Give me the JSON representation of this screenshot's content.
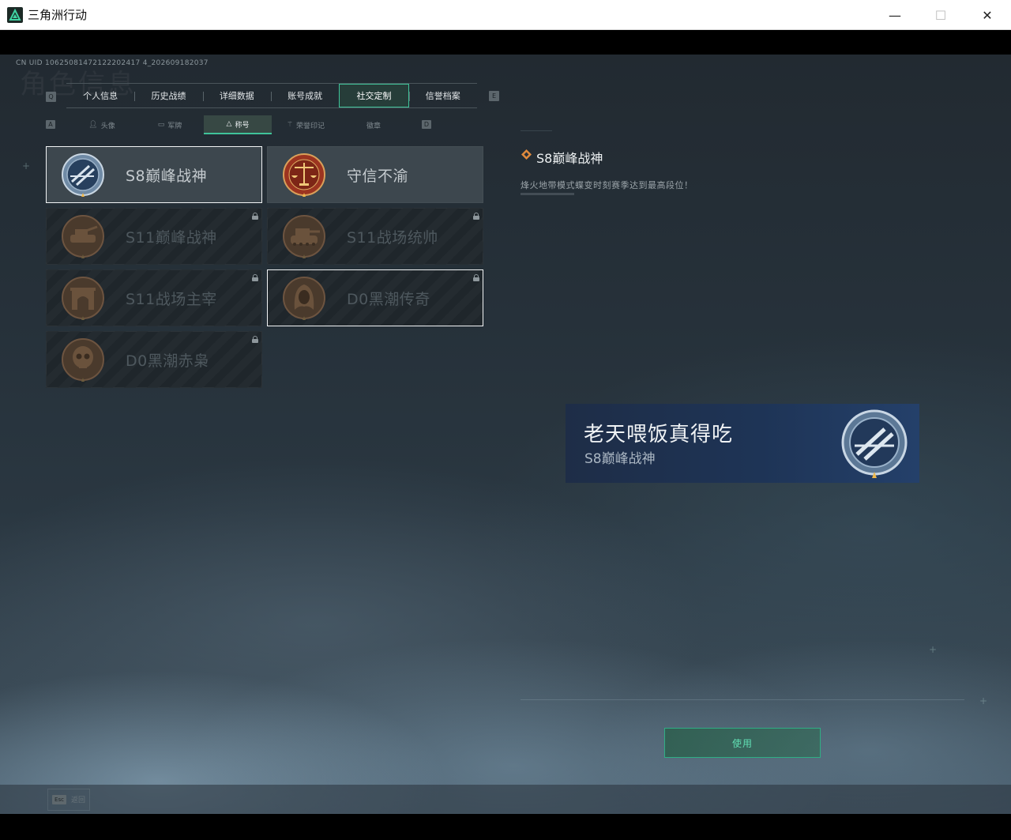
{
  "window": {
    "title": "三角洲行动",
    "minimize": "—",
    "maximize": "☐",
    "close": "✕"
  },
  "uid_text": "CN UID 10625081472122202417 4_202609182037",
  "watermark": "角色信息",
  "main_tabs": {
    "left_key": "Q",
    "right_key": "E",
    "items": [
      {
        "label": "个人信息"
      },
      {
        "label": "历史战绩"
      },
      {
        "label": "详细数据"
      },
      {
        "label": "账号成就"
      },
      {
        "label": "社交定制",
        "active": true
      },
      {
        "label": "信誉档案"
      }
    ]
  },
  "sub_tabs": {
    "left_key": "A",
    "right_key": "D",
    "items": [
      {
        "label": "头像",
        "icon": "person-icon"
      },
      {
        "label": "军牌",
        "icon": "dogtag-icon"
      },
      {
        "label": "称号",
        "icon": "title-icon",
        "active": true
      },
      {
        "label": "荣誉印记",
        "icon": "honor-icon"
      },
      {
        "label": "徽章",
        "icon": "badge-icon"
      }
    ]
  },
  "titles": [
    {
      "label": "S8巅峰战神",
      "locked": false,
      "selected": true,
      "emblem": "wings-emblem"
    },
    {
      "label": "守信不渝",
      "locked": false,
      "selected": false,
      "emblem": "scales-emblem"
    },
    {
      "label": "S11巅峰战神",
      "locked": true,
      "selected": false,
      "emblem": "tank-emblem"
    },
    {
      "label": "S11战场统帅",
      "locked": true,
      "selected": false,
      "emblem": "tank-emblem"
    },
    {
      "label": "S11战场主宰",
      "locked": true,
      "selected": false,
      "emblem": "arch-emblem"
    },
    {
      "label": "D0黑潮传奇",
      "locked": true,
      "selected": false,
      "emblem": "hood-emblem"
    },
    {
      "label": "D0黑潮赤枭",
      "locked": true,
      "selected": false,
      "emblem": "skull-emblem"
    }
  ],
  "detail": {
    "title": "S8巅峰战神",
    "description": "烽火地带模式蝶变时刻赛季达到最高段位！"
  },
  "preview": {
    "player_name": "老天喂饭真得吃",
    "title": "S8巅峰战神"
  },
  "use_button": "使用",
  "footer": {
    "esc_key": "Esc",
    "esc_label": "返回"
  },
  "colors": {
    "accent": "#3fc39a",
    "preview_bg": "#1e3456",
    "diamond": "#e08a3c"
  }
}
